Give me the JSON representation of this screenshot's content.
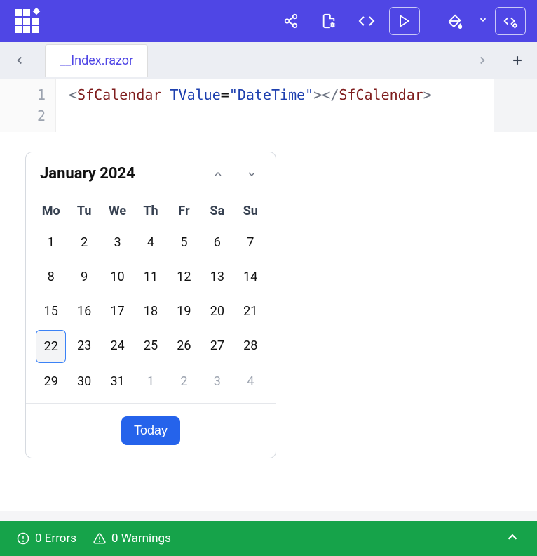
{
  "tabs": {
    "active": "__Index.razor"
  },
  "editor": {
    "lines": [
      "1",
      "2"
    ],
    "code": {
      "lt1": "<",
      "tag_open": "SfCalendar",
      "sp": " ",
      "attr": "TValue",
      "eq": "=",
      "str": "\"DateTime\"",
      "gt1": ">",
      "lt2": "</",
      "tag_close": "SfCalendar",
      "gt2": ">"
    }
  },
  "calendar": {
    "title": "January 2024",
    "dow": [
      "Mo",
      "Tu",
      "We",
      "Th",
      "Fr",
      "Sa",
      "Su"
    ],
    "days": [
      {
        "n": "1"
      },
      {
        "n": "2"
      },
      {
        "n": "3"
      },
      {
        "n": "4"
      },
      {
        "n": "5"
      },
      {
        "n": "6"
      },
      {
        "n": "7"
      },
      {
        "n": "8"
      },
      {
        "n": "9"
      },
      {
        "n": "10"
      },
      {
        "n": "11"
      },
      {
        "n": "12"
      },
      {
        "n": "13"
      },
      {
        "n": "14"
      },
      {
        "n": "15"
      },
      {
        "n": "16"
      },
      {
        "n": "17"
      },
      {
        "n": "18"
      },
      {
        "n": "19"
      },
      {
        "n": "20"
      },
      {
        "n": "21"
      },
      {
        "n": "22",
        "today": true
      },
      {
        "n": "23"
      },
      {
        "n": "24"
      },
      {
        "n": "25"
      },
      {
        "n": "26"
      },
      {
        "n": "27"
      },
      {
        "n": "28"
      },
      {
        "n": "29"
      },
      {
        "n": "30"
      },
      {
        "n": "31"
      },
      {
        "n": "1",
        "other": true
      },
      {
        "n": "2",
        "other": true
      },
      {
        "n": "3",
        "other": true
      },
      {
        "n": "4",
        "other": true
      }
    ],
    "today_label": "Today"
  },
  "status": {
    "errors": "0 Errors",
    "warnings": "0 Warnings"
  }
}
